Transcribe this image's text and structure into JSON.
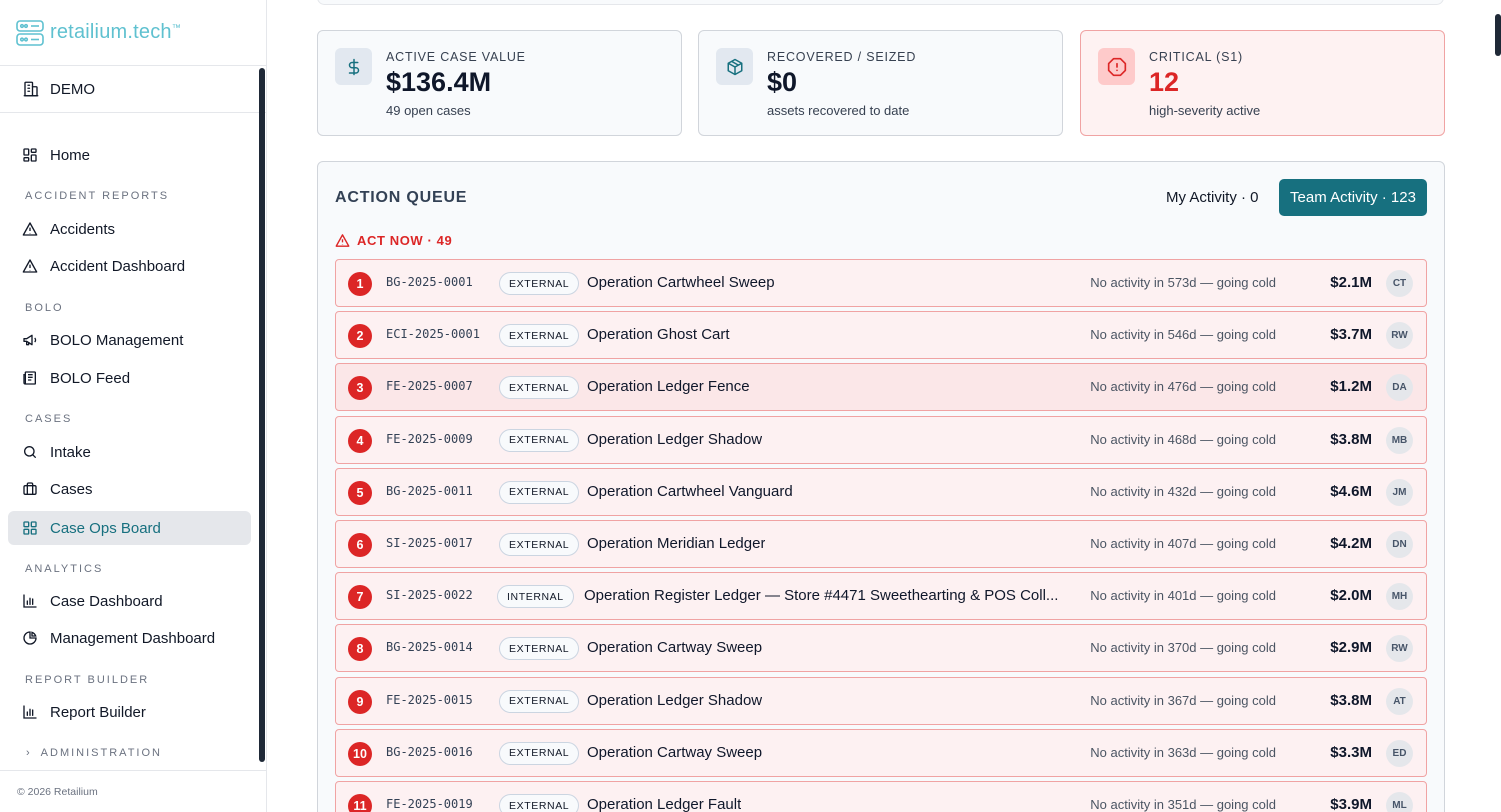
{
  "brand": {
    "name": "retailium.tech",
    "tm": "™"
  },
  "org": {
    "name": "DEMO"
  },
  "nav": {
    "home": "Home",
    "sections": {
      "accident_reports": "ACCIDENT REPORTS",
      "bolo": "BOLO",
      "cases": "CASES",
      "analytics": "ANALYTICS",
      "report_builder": "REPORT BUILDER",
      "administration": "ADMINISTRATION"
    },
    "items": {
      "accidents": "Accidents",
      "accident_dashboard": "Accident Dashboard",
      "bolo_management": "BOLO Management",
      "bolo_feed": "BOLO Feed",
      "intake": "Intake",
      "cases": "Cases",
      "case_ops_board": "Case Ops Board",
      "case_dashboard": "Case Dashboard",
      "management_dashboard": "Management Dashboard",
      "report_builder": "Report Builder"
    },
    "active": "case_ops_board"
  },
  "footer": "© 2026 Retailium",
  "cards": {
    "active": {
      "label": "ACTIVE CASE VALUE",
      "value": "$136.4M",
      "sub": "49 open cases"
    },
    "recovered": {
      "label": "RECOVERED / SEIZED",
      "value": "$0",
      "sub": "assets recovered to date"
    },
    "critical": {
      "label": "CRITICAL (S1)",
      "value": "12",
      "sub": "high-severity active"
    }
  },
  "colors": {
    "accent": "#17707f",
    "critical": "#dc2626",
    "brand": "#5fc1d0"
  },
  "queue": {
    "title": "ACTION QUEUE",
    "my_activity": "My Activity · 0",
    "team_activity": "Team Activity · 123",
    "act_now": "ACT NOW · 49",
    "rows": [
      {
        "n": "1",
        "id": "BG-2025-0001",
        "tag": "EXTERNAL",
        "name": "Operation Cartwheel Sweep",
        "status": "No activity in 573d — going cold",
        "amount": "$2.1M",
        "initials": "CT"
      },
      {
        "n": "2",
        "id": "ECI-2025-0001",
        "tag": "EXTERNAL",
        "name": "Operation Ghost Cart",
        "status": "No activity in 546d — going cold",
        "amount": "$3.7M",
        "initials": "RW"
      },
      {
        "n": "3",
        "id": "FE-2025-0007",
        "tag": "EXTERNAL",
        "name": "Operation Ledger Fence",
        "status": "No activity in 476d — going cold",
        "amount": "$1.2M",
        "initials": "DA"
      },
      {
        "n": "4",
        "id": "FE-2025-0009",
        "tag": "EXTERNAL",
        "name": "Operation Ledger Shadow",
        "status": "No activity in 468d — going cold",
        "amount": "$3.8M",
        "initials": "MB"
      },
      {
        "n": "5",
        "id": "BG-2025-0011",
        "tag": "EXTERNAL",
        "name": "Operation Cartwheel Vanguard",
        "status": "No activity in 432d — going cold",
        "amount": "$4.6M",
        "initials": "JM"
      },
      {
        "n": "6",
        "id": "SI-2025-0017",
        "tag": "EXTERNAL",
        "name": "Operation Meridian Ledger",
        "status": "No activity in 407d — going cold",
        "amount": "$4.2M",
        "initials": "DN"
      },
      {
        "n": "7",
        "id": "SI-2025-0022",
        "tag": "INTERNAL",
        "name": "Operation Register Ledger — Store #4471 Sweethearting & POS Coll...",
        "status": "No activity in 401d — going cold",
        "amount": "$2.0M",
        "initials": "MH"
      },
      {
        "n": "8",
        "id": "BG-2025-0014",
        "tag": "EXTERNAL",
        "name": "Operation Cartway Sweep",
        "status": "No activity in 370d — going cold",
        "amount": "$2.9M",
        "initials": "RW"
      },
      {
        "n": "9",
        "id": "FE-2025-0015",
        "tag": "EXTERNAL",
        "name": "Operation Ledger Shadow",
        "status": "No activity in 367d — going cold",
        "amount": "$3.8M",
        "initials": "AT"
      },
      {
        "n": "10",
        "id": "BG-2025-0016",
        "tag": "EXTERNAL",
        "name": "Operation Cartway Sweep",
        "status": "No activity in 363d — going cold",
        "amount": "$3.3M",
        "initials": "ED"
      },
      {
        "n": "11",
        "id": "FE-2025-0019",
        "tag": "EXTERNAL",
        "name": "Operation Ledger Fault",
        "status": "No activity in 351d — going cold",
        "amount": "$3.9M",
        "initials": "ML"
      }
    ]
  }
}
